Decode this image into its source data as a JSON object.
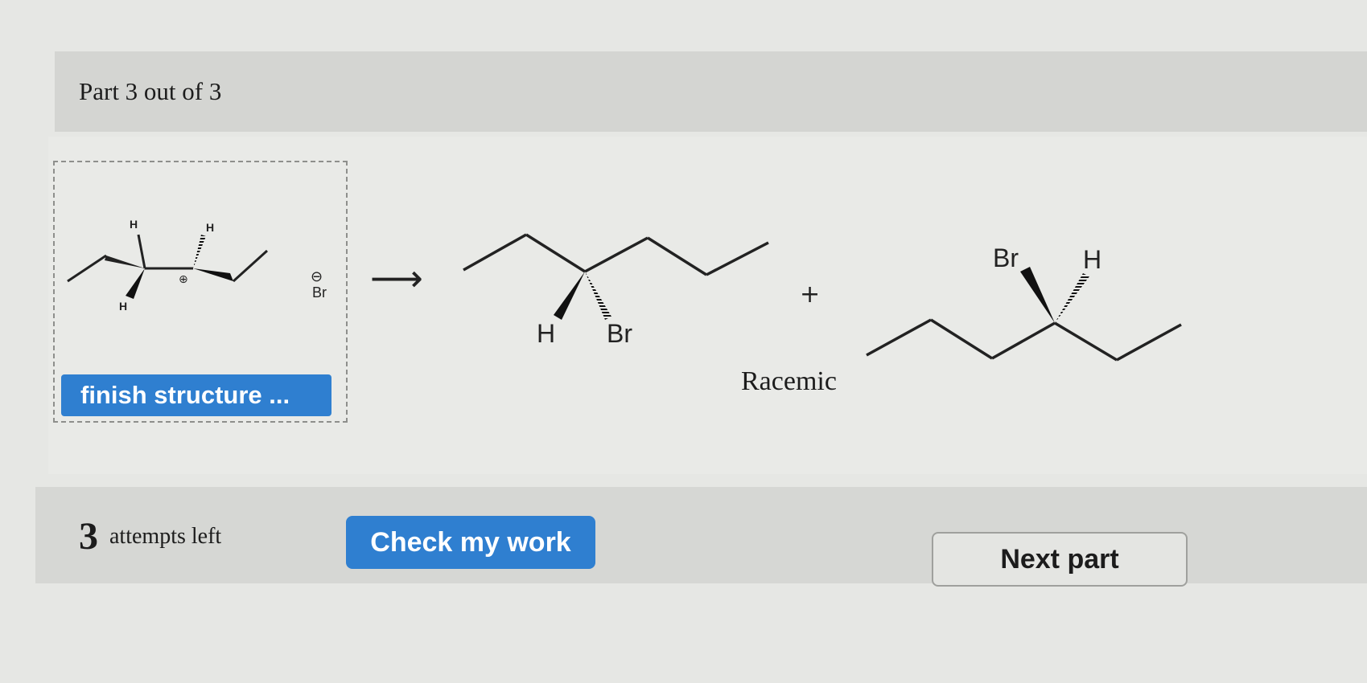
{
  "header": {
    "part_title": "Part 3 out of 3"
  },
  "reactant": {
    "h_top_left": "H",
    "h_top_right": "H",
    "h_bottom_left": "H",
    "carbocation_charge": "⊕",
    "bromide_charge": "⊖",
    "bromide_label": "Br",
    "finish_button_label": "finish structure ..."
  },
  "reaction": {
    "arrow": "⟶",
    "plus": "+"
  },
  "product_1": {
    "h_label": "H",
    "br_label": "Br"
  },
  "product_2": {
    "br_label": "Br",
    "h_label": "H"
  },
  "racemic_label": "Racemic",
  "footer": {
    "attempts_count": "3",
    "attempts_label": "attempts left",
    "check_button_label": "Check my work",
    "next_button_label": "Next part"
  },
  "colors": {
    "accent_blue": "#2f7fd0",
    "header_band": "#d4d5d2",
    "footer_band": "#d6d7d4"
  }
}
